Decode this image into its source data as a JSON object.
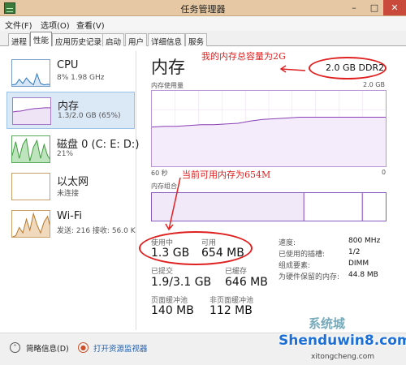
{
  "window": {
    "title": "任务管理器",
    "minimize": "–",
    "maximize": "□",
    "close": "✕"
  },
  "menu": [
    "文件(F)",
    "选项(O)",
    "查看(V)"
  ],
  "tabs": [
    "进程",
    "性能",
    "应用历史记录",
    "启动",
    "用户",
    "详细信息",
    "服务"
  ],
  "active_tab": "性能",
  "sidebar": {
    "items": [
      {
        "name": "CPU",
        "sub": "8% 1.98 GHz"
      },
      {
        "name": "内存",
        "sub": "1.3/2.0 GB (65%)"
      },
      {
        "name": "磁盘 0 (C: E: D:)",
        "sub": "21%"
      },
      {
        "name": "以太网",
        "sub": "未连接"
      },
      {
        "name": "Wi-Fi",
        "sub": "发送: 216 接收: 56.0 K"
      }
    ],
    "cpu_history": [
      0.1,
      0.12,
      0.3,
      0.15,
      0.35,
      0.2,
      0.1,
      0.5,
      0.15,
      0.1,
      0.12,
      0.1
    ],
    "memory_history": [
      0.5,
      0.52,
      0.53,
      0.55,
      0.58,
      0.6,
      0.62,
      0.63,
      0.64,
      0.65,
      0.65,
      0.65
    ],
    "disk_history": [
      0.3,
      0.8,
      0.2,
      0.7,
      0.9,
      0.1,
      0.6,
      0.85,
      0.2,
      0.7,
      0.3,
      0.1
    ],
    "wifi_history": [
      0.05,
      0.1,
      0.4,
      0.2,
      0.7,
      0.3,
      0.9,
      0.5,
      0.2,
      0.6,
      0.8,
      0.3
    ]
  },
  "detail": {
    "title": "内存",
    "total": "2.0 GB DDR2",
    "usage_label": "内存使用量",
    "max_label": "2.0 GB",
    "time_left": "60 秒",
    "time_right": "0",
    "composition_label": "内存组合",
    "usage_history": [
      0.52,
      0.53,
      0.53,
      0.54,
      0.55,
      0.55,
      0.56,
      0.57,
      0.6,
      0.62,
      0.63,
      0.64,
      0.65,
      0.65,
      0.65,
      0.65,
      0.65,
      0.65,
      0.65,
      0.65
    ],
    "in_use": {
      "label": "使用中",
      "value": "1.3 GB"
    },
    "available": {
      "label": "可用",
      "value": "654 MB"
    },
    "committed": {
      "label": "已提交",
      "value": "1.9/3.1 GB"
    },
    "cached": {
      "label": "已缓存",
      "value": "646 MB"
    },
    "paged_pool": {
      "label": "页面缓冲池",
      "value": "140 MB"
    },
    "nonpaged_pool": {
      "label": "非页面缓冲池",
      "value": "112 MB"
    },
    "specs": [
      {
        "key": "速度:",
        "value": "800 MHz"
      },
      {
        "key": "已使用的插槽:",
        "value": "1/2"
      },
      {
        "key": "组成要素:",
        "value": "DIMM"
      },
      {
        "key": "为硬件保留的内存:",
        "value": "44.8 MB"
      }
    ]
  },
  "annotations": {
    "total_note": "我的内存总容量为2G",
    "available_note": "当前可用内存为654M"
  },
  "footer": {
    "summary": "简略信息(D)",
    "resource_monitor": "打开资源监视器"
  },
  "watermark": {
    "top": "系统城",
    "main": "Shenduwin8.com",
    "sub": "xitongcheng.com"
  },
  "colors": {
    "memory": "#8a3fb5",
    "cpu": "#2a75c4",
    "disk": "#3f9b3f",
    "wifi": "#b8772a",
    "annotation": "#e02020"
  }
}
